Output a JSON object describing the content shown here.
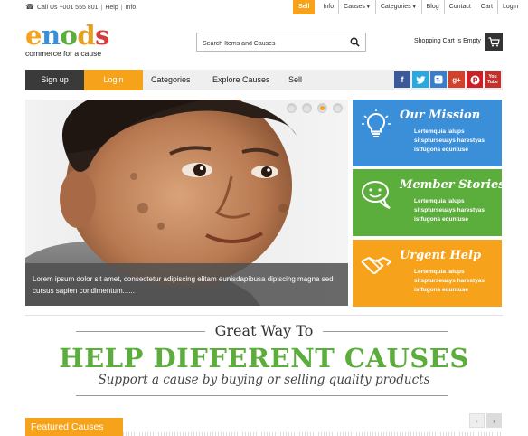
{
  "topbar": {
    "call_label": "Call Us +001 555 801",
    "help_link": "Help",
    "info_link": "Info",
    "nav": [
      {
        "label": "Sell"
      },
      {
        "label": "Info"
      },
      {
        "label": "Causes",
        "dropdown": true
      },
      {
        "label": "Categories",
        "dropdown": true
      },
      {
        "label": "Blog"
      },
      {
        "label": "Contact"
      },
      {
        "label": "Cart"
      },
      {
        "label": "Login"
      }
    ]
  },
  "logo": {
    "letters": [
      "e",
      "n",
      "o",
      "d",
      "s"
    ],
    "letter_colors": [
      "#f7a21b",
      "#3b8fd9",
      "#5cae3c",
      "#e8a020",
      "#d93b3b"
    ],
    "tagline": "commerce for a cause"
  },
  "search": {
    "placeholder": "Search Items and Causes"
  },
  "cart": {
    "status": "Shopping Cart Is Empty"
  },
  "nav": {
    "signup": "Sign up",
    "login": "Login",
    "categories": "Categories",
    "explore": "Explore Causes",
    "sell": "Sell",
    "social": [
      {
        "icon": "facebook-icon",
        "glyph": "f",
        "color": "#3b5998"
      },
      {
        "icon": "twitter-icon",
        "glyph": "t",
        "color": "#2aa9e0"
      },
      {
        "icon": "blogger-icon",
        "glyph": "B",
        "color": "#3a7ec9"
      },
      {
        "icon": "google-plus-icon",
        "glyph": "g+",
        "color": "#d1412c"
      },
      {
        "icon": "pinterest-icon",
        "glyph": "P",
        "color": "#cb2027"
      },
      {
        "icon": "youtube-icon",
        "glyph": "You Tube",
        "color": "#c4302b"
      }
    ]
  },
  "hero": {
    "caption": "Lorem ipsum dolor sit amet, consectetur adipiscing elitam eunisdapibusa dipiscing magna sed cursus sapien condimentum......",
    "slides": 4,
    "active_slide": 3
  },
  "boxes": [
    {
      "title": "Our Mission",
      "icon": "lightbulb-icon",
      "color": "#3b8fd9",
      "lines": [
        "Lertemquia lalups",
        "sitspturseuays harestyas",
        "istfugons equntuse"
      ]
    },
    {
      "title": "Member Stories",
      "icon": "chat-bubble-icon",
      "color": "#5cae3c",
      "lines": [
        "Lertemquia lalups",
        "sitspturseuays harestyas",
        "istfugons equntuse"
      ]
    },
    {
      "title": "Urgent Help",
      "icon": "handshake-icon",
      "color": "#f7a21b",
      "lines": [
        "Lertemquia lalups",
        "sitspturseuays harestyas",
        "istfugons equntuse"
      ]
    }
  ],
  "tagline": {
    "top": "Great Way To",
    "main": "HELP DIFFERENT CAUSES",
    "sub": "Support a cause by buying or selling quality products"
  },
  "featured": {
    "title": "Featured Causes",
    "prev": "‹",
    "next": "›"
  }
}
